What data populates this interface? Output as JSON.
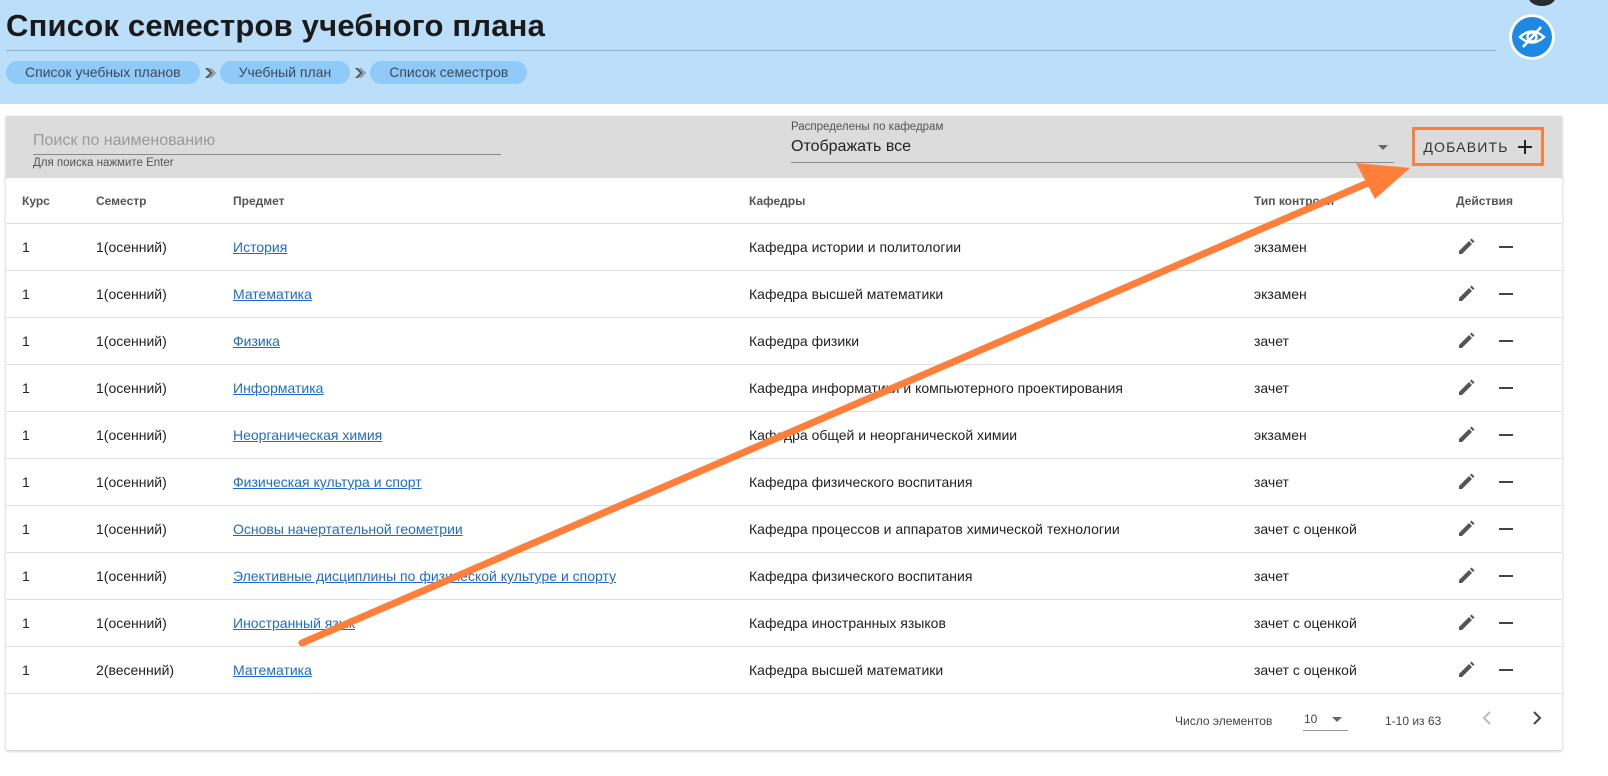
{
  "header": {
    "title": "Список семестров учебного плана",
    "breadcrumbs": [
      "Список учебных планов",
      "Учебный план",
      "Список семестров"
    ]
  },
  "toolbar": {
    "search_placeholder": "Поиск по наименованию",
    "search_hint": "Для поиска нажмите Enter",
    "filter_label": "Распределены по кафедрам",
    "filter_value": "Отображать все",
    "add_label": "ДОБАВИТЬ"
  },
  "table": {
    "headers": [
      "Курс",
      "Семестр",
      "Предмет",
      "Кафедры",
      "Тип контроля",
      "Действия"
    ],
    "rows": [
      [
        "1",
        "1(осенний)",
        "История",
        "Кафедра истории и политологии",
        "экзамен"
      ],
      [
        "1",
        "1(осенний)",
        "Математика",
        "Кафедра высшей математики",
        "экзамен"
      ],
      [
        "1",
        "1(осенний)",
        "Физика",
        "Кафедра физики",
        "зачет"
      ],
      [
        "1",
        "1(осенний)",
        "Информатика",
        "Кафедра информатики и компьютерного проектирования",
        "зачет"
      ],
      [
        "1",
        "1(осенний)",
        "Неорганическая химия",
        "Кафедра общей и неорганической химии",
        "экзамен"
      ],
      [
        "1",
        "1(осенний)",
        "Физическая культура и спорт",
        "Кафедра физического воспитания",
        "зачет"
      ],
      [
        "1",
        "1(осенний)",
        "Основы начертательной геометрии",
        "Кафедра процессов и аппаратов химической технологии",
        "зачет с оценкой"
      ],
      [
        "1",
        "1(осенний)",
        "Элективные дисциплины по физической культуре и спорту",
        "Кафедра физического воспитания",
        "зачет"
      ],
      [
        "1",
        "1(осенний)",
        "Иностранный язык",
        "Кафедра иностранных языков",
        "зачет с оценкой"
      ],
      [
        "1",
        "2(весенний)",
        "Математика",
        "Кафедра высшей математики",
        "зачет с оценкой"
      ]
    ]
  },
  "footer": {
    "per_page_label": "Число элементов",
    "per_page_value": "10",
    "range": "1-10 из 63"
  },
  "colors": {
    "header_bg": "#bbdefb",
    "crumb_bg": "#90caf9",
    "accent": "#1e88e5",
    "annotation": "#ff7f3a",
    "link": "#1e6bd0"
  }
}
